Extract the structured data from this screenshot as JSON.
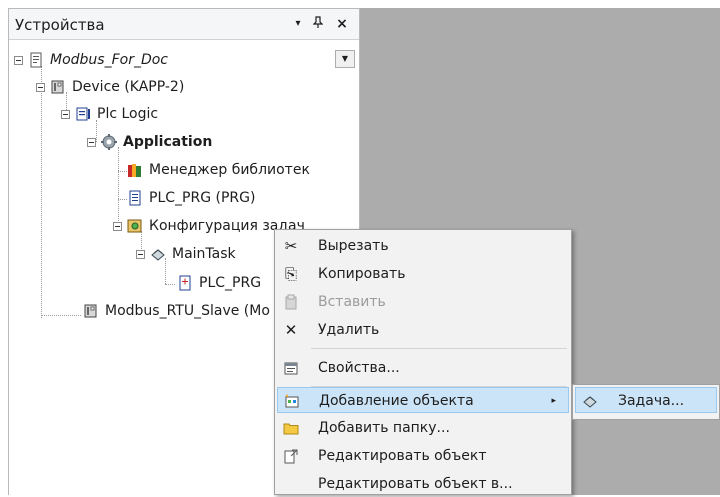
{
  "panel": {
    "title": "Устройства",
    "dropdown_glyph": "▾",
    "pin_glyph": "ᵽ",
    "close_glyph": "×"
  },
  "tree": {
    "root": "Modbus_For_Doc",
    "device": "Device (KAPP-2)",
    "plc_logic": "Plc Logic",
    "application": "Application",
    "library_manager": "Менеджер библиотек",
    "plc_prg": "PLC_PRG (PRG)",
    "task_config": "Конфигурация задач",
    "main_task": "MainTask",
    "main_task_prg": "PLC_PRG",
    "modbus_slave": "Modbus_RTU_Slave (Mo"
  },
  "context_menu": {
    "items": [
      {
        "label": "Вырезать",
        "icon": "scissors-icon",
        "glyph": "✂"
      },
      {
        "label": "Копировать",
        "icon": "copy-icon",
        "glyph": "⎘"
      },
      {
        "label": "Вставить",
        "icon": "paste-icon",
        "glyph": "📋"
      },
      {
        "label": "Удалить",
        "icon": "delete-icon",
        "glyph": "✕"
      },
      {
        "label": "Свойства...",
        "icon": "properties-icon",
        "glyph": "☷"
      },
      {
        "label": "Добавление объекта",
        "icon": "add-object-icon",
        "glyph": "✦"
      },
      {
        "label": "Добавить папку...",
        "icon": "folder-icon",
        "glyph": "▭"
      },
      {
        "label": "Редактировать объект",
        "icon": "edit-icon",
        "glyph": "↗"
      },
      {
        "label": "Редактировать объект в...",
        "icon": "",
        "glyph": ""
      }
    ],
    "submenu_arrow": "▸"
  },
  "submenu": {
    "items": [
      {
        "label": "Задача...",
        "icon": "task-icon",
        "glyph": "☸"
      }
    ]
  },
  "colors": {
    "highlight": "#cce4f7",
    "highlight_border": "#99c9ef",
    "menu_bg": "#f2f2f2",
    "gray_area": "#acacac"
  }
}
